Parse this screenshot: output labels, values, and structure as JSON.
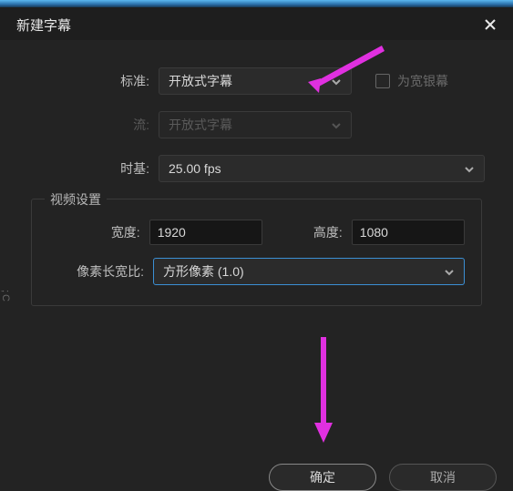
{
  "dialog": {
    "title": "新建字幕",
    "labels": {
      "standard": "标准:",
      "stream": "流:",
      "timebase": "时基:"
    },
    "values": {
      "standard": "开放式字幕",
      "stream": "开放式字幕",
      "timebase": "25.00 fps"
    },
    "widescreen": {
      "label": "为宽银幕"
    }
  },
  "video": {
    "legend": "视频设置",
    "labels": {
      "width": "宽度:",
      "height": "高度:",
      "par": "像素长宽比:"
    },
    "values": {
      "width": "1920",
      "height": "1080",
      "par": "方形像素 (1.0)"
    }
  },
  "buttons": {
    "ok": "确定",
    "cancel": "取消"
  },
  "side_hint": ";C"
}
